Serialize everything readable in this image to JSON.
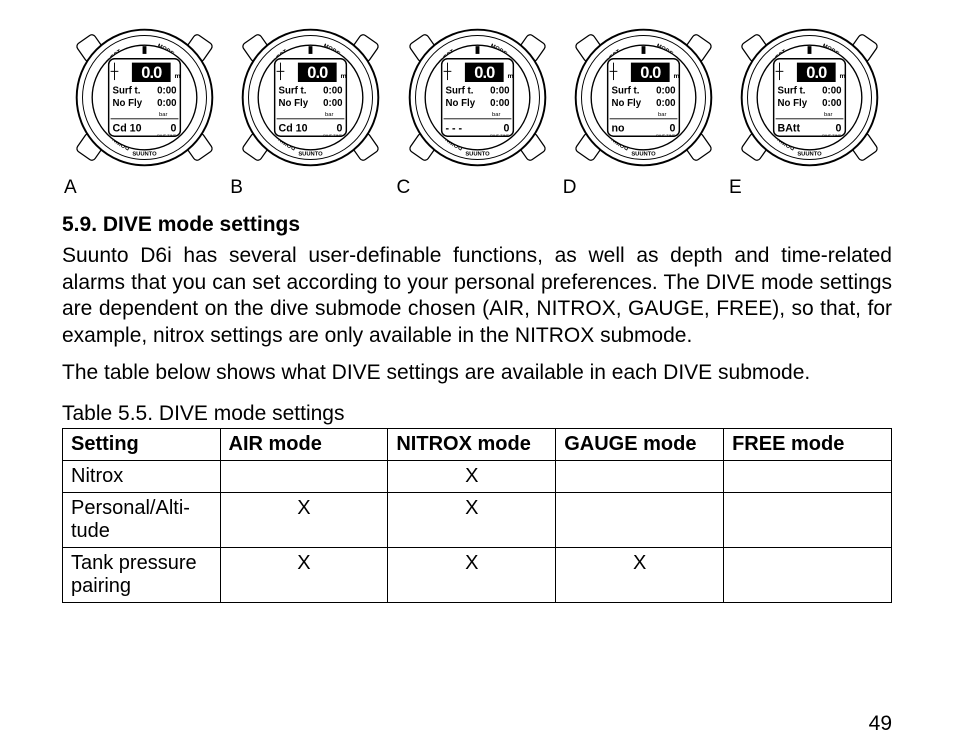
{
  "watches": {
    "common": {
      "depth": "0.0",
      "depth_unit": "m",
      "line1_label": "Surf t.",
      "line1_value": "0:00",
      "line2_label": "No Fly",
      "line2_value": "0:00",
      "bar_label": "bar"
    },
    "items": [
      {
        "label": "A",
        "bottom_left": "Cd 10",
        "bottom_right": "0"
      },
      {
        "label": "B",
        "bottom_left": "Cd 10",
        "bottom_right": "0"
      },
      {
        "label": "C",
        "bottom_left": "- - -",
        "bottom_right": "0"
      },
      {
        "label": "D",
        "bottom_left": "no",
        "bottom_right": "0"
      },
      {
        "label": "E",
        "bottom_left": "BAtt",
        "bottom_right": "0"
      }
    ],
    "bezel": {
      "tl": "SELECT",
      "tr": "MODE",
      "bl": "DOWN",
      "br": "UP",
      "brand": "SUUNTO",
      "divetime": "DIVE TIME"
    }
  },
  "section": {
    "heading": "5.9. DIVE mode settings",
    "para1": "Suunto D6i has several user-definable functions, as well as depth and time-related alarms that you can set according to your personal preferences. The DIVE mode settings are dependent on the dive submode chosen (AIR, NITROX, GAUGE, FREE), so that, for example, nitrox settings are only available in the NITROX submode.",
    "para2": "The table below shows what DIVE settings are available in each DIVE submode."
  },
  "table": {
    "caption": "Table 5.5. DIVE mode settings",
    "headers": [
      "Setting",
      "AIR mode",
      "NITROX mode",
      "GAUGE mode",
      "FREE mode"
    ],
    "rows": [
      {
        "setting": "Nitrox",
        "air": "",
        "nitrox": "X",
        "gauge": "",
        "free": ""
      },
      {
        "setting": "Personal/Altitude",
        "air": "X",
        "nitrox": "X",
        "gauge": "",
        "free": ""
      },
      {
        "setting": "Tank pressure pairing",
        "air": "X",
        "nitrox": "X",
        "gauge": "X",
        "free": ""
      }
    ]
  },
  "page_number": "49"
}
